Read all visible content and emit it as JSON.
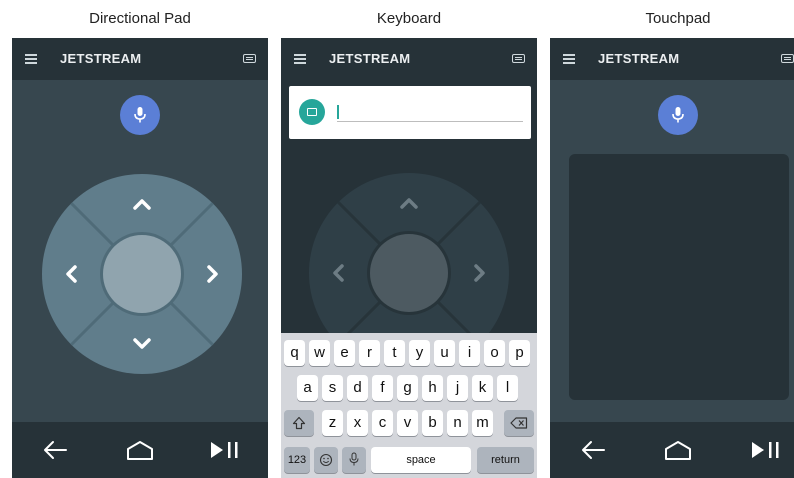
{
  "captions": [
    "Directional Pad",
    "Keyboard",
    "Touchpad"
  ],
  "app_title": "JETSTREAM",
  "icons": {
    "menu": "hamburger-menu-icon",
    "keyboard": "keyboard-icon",
    "mic": "microphone-icon",
    "back": "back-arrow-icon",
    "home": "home-icon",
    "play_pause": "play-pause-icon"
  },
  "colors": {
    "screen_bg": "#37474f",
    "app_bar": "#263238",
    "mic_blue": "#5b7fd6",
    "dpad": "#607d8b",
    "dpad_center": "#90a4ae",
    "teal": "#26a69a"
  },
  "keyboard": {
    "row1": [
      "q",
      "w",
      "e",
      "r",
      "t",
      "y",
      "u",
      "i",
      "o",
      "p"
    ],
    "row2": [
      "a",
      "s",
      "d",
      "f",
      "g",
      "h",
      "j",
      "k",
      "l"
    ],
    "row3": [
      "z",
      "x",
      "c",
      "v",
      "b",
      "n",
      "m"
    ],
    "numbers_key": "123",
    "space_key": "space",
    "return_key": "return"
  }
}
